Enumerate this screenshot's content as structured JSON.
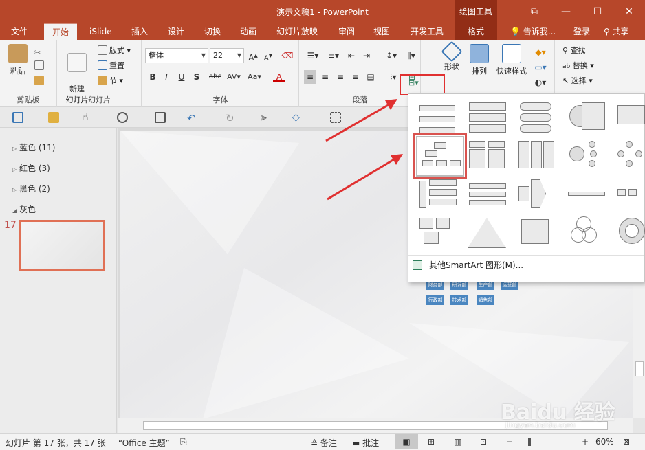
{
  "window": {
    "title": "演示文稿1 - PowerPoint",
    "context_group": "绘图工具",
    "controls": [
      "⧉",
      "—",
      "☐",
      "✕"
    ]
  },
  "tabs": [
    "文件",
    "开始",
    "iSlide",
    "插入",
    "设计",
    "切换",
    "动画",
    "幻灯片放映",
    "审阅",
    "视图",
    "开发工具",
    "格式"
  ],
  "tell_me": "告诉我...",
  "login": "登录",
  "share": "共享",
  "ribbon": {
    "clipboard": {
      "label": "剪贴板",
      "paste": "粘贴"
    },
    "slides": {
      "label": "幻灯片",
      "new_slide": "新建\n幻灯片",
      "layout": "版式",
      "reset": "重置",
      "section": "节"
    },
    "font": {
      "label": "字体",
      "font_name": "楷体",
      "font_size": "22"
    },
    "paragraph": {
      "label": "段落"
    },
    "drawing": {
      "shapes": "形状",
      "arrange": "排列",
      "quick_styles": "快速样式"
    },
    "editing": {
      "find": "查找",
      "replace": "替换",
      "select": "选择"
    }
  },
  "sections": [
    {
      "name": "蓝色 (11)",
      "state": "collapsed"
    },
    {
      "name": "红色 (3)",
      "state": "collapsed"
    },
    {
      "name": "黑色 (2)",
      "state": "collapsed"
    },
    {
      "name": "灰色",
      "state": "expanded"
    }
  ],
  "slide_number": "17",
  "slide": {
    "org_boxes": [
      "财务部",
      "研发部",
      "生产部",
      "运营部",
      "行政部",
      "技术部",
      "销售部"
    ]
  },
  "smartart_menu": {
    "more": "其他SmartArt 图形(M)..."
  },
  "status": {
    "slide_info": "幻灯片 第 17 张，共 17 张",
    "theme": "“Office 主题”",
    "notes": "备注",
    "comments": "批注",
    "zoom": "60%"
  },
  "watermark": {
    "brand": "Baidu 经验",
    "url": "jingyan.baidu.com"
  },
  "colors": {
    "accent": "#b7472a",
    "highlight": "#e03030",
    "org_box": "#4a86c0"
  }
}
